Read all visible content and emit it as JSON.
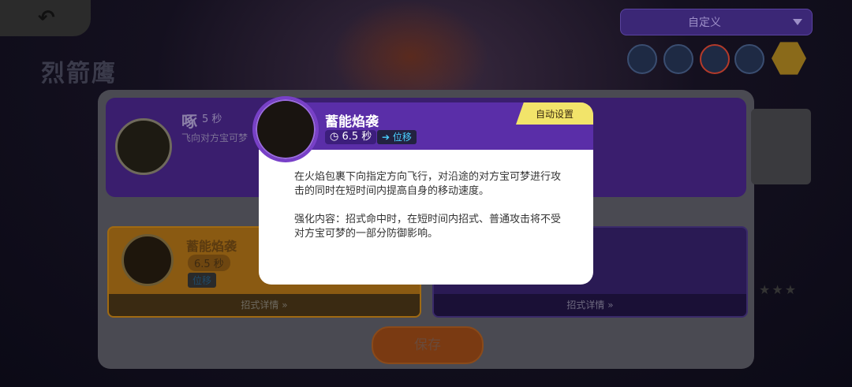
{
  "header": {
    "back_icon": "back-arrow-icon",
    "pokemon_name": "烈箭鹰",
    "dropdown_label": "自定义"
  },
  "skill_icons": [
    "settings-icon",
    "wing-icon",
    "flame-dash-icon",
    "bird-icon",
    "flame-hex-icon"
  ],
  "card1": {
    "name": "啄",
    "cooldown": "5 秒",
    "desc": "飞向对方宝可梦"
  },
  "card2": {
    "name": "蓄能焰袭",
    "cooldown": "6.5 秒",
    "tag": "位移",
    "detail": "招式详情"
  },
  "card3": {
    "detail": "招式详情"
  },
  "save_label": "保存",
  "popup": {
    "name": "蓄能焰袭",
    "cooldown": "6.5 秒",
    "tag": "位移",
    "auto_setting": "自动设置",
    "desc1": "在火焰包裹下向指定方向飞行，对沿途的对方宝可梦进行攻击的同时在短时间内提高自身的移动速度。",
    "desc2": "强化内容：招式命中时，在短时间内招式、普通攻击将不受对方宝可梦的一部分防御影响。"
  },
  "colors": {
    "popup_header": "#5a2ea8",
    "auto_badge": "#f2e46a",
    "tag_text": "#4ad0ff",
    "save": "#7a3a12"
  }
}
